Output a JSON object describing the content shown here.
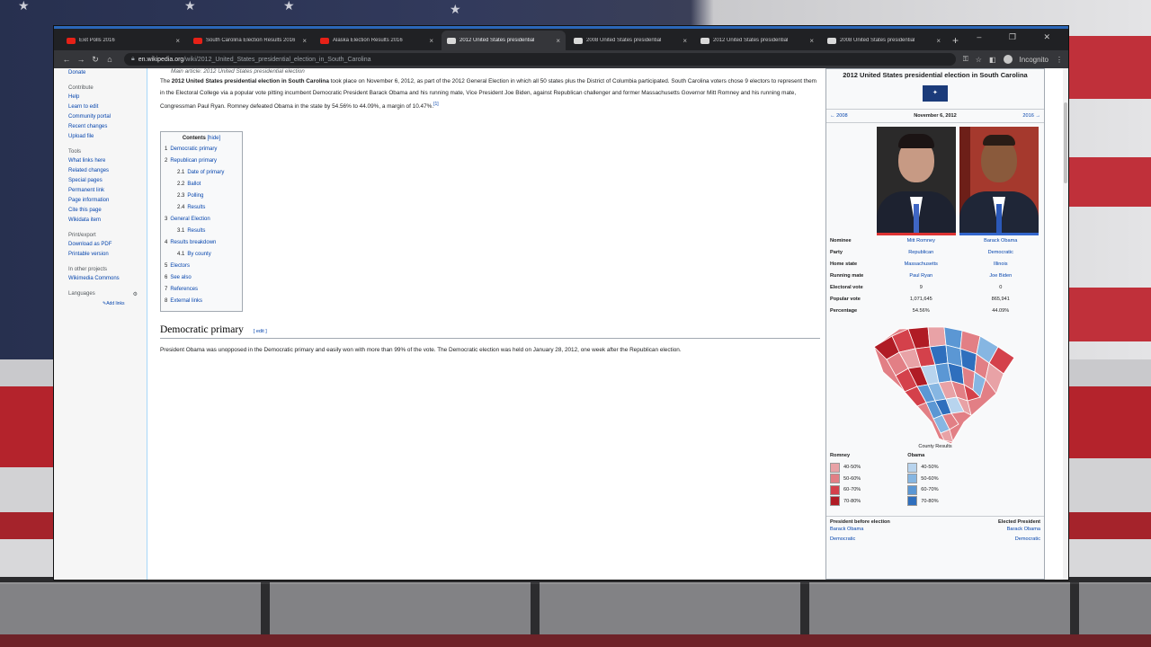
{
  "theme": {
    "republican": "#dd3333",
    "democratic": "#3366cc",
    "link": "#0645ad",
    "flag_blue": "#1b3b7a"
  },
  "browser": {
    "tabs": [
      {
        "title": "Exit Polls 2016",
        "icon": "youtube-icon",
        "active": false
      },
      {
        "title": "South Carolina Election Results 2016",
        "icon": "youtube-icon",
        "active": false
      },
      {
        "title": "Alaska Election Results 2016",
        "icon": "youtube-icon",
        "active": false
      },
      {
        "title": "2012 United States presidential",
        "icon": "wikipedia-icon",
        "active": true
      },
      {
        "title": "2008 United States presidential",
        "icon": "wikipedia-icon",
        "active": false
      },
      {
        "title": "2012 United States presidential",
        "icon": "wikipedia-icon",
        "active": false
      },
      {
        "title": "2008 United States presidential",
        "icon": "wikipedia-icon",
        "active": false
      }
    ],
    "new_tab": "+",
    "url_host": "en.wikipedia.org",
    "url_path": "/wiki/2012_United_States_presidential_election_in_South_Carolina",
    "profile_label": "Incognito"
  },
  "sidebar": {
    "top": [
      "Donate"
    ],
    "contribute_heading": "Contribute",
    "contribute": [
      "Help",
      "Learn to edit",
      "Community portal",
      "Recent changes",
      "Upload file"
    ],
    "tools_heading": "Tools",
    "tools": [
      "What links here",
      "Related changes",
      "Special pages",
      "Permanent link",
      "Page information",
      "Cite this page",
      "Wikidata item"
    ],
    "print_heading": "Print/export",
    "print": [
      "Download as PDF",
      "Printable version"
    ],
    "other_heading": "In other projects",
    "other": [
      "Wikimedia Commons"
    ],
    "languages_heading": "Languages",
    "add_links": "Add links"
  },
  "article": {
    "hatnote": "Main article: 2012 United States presidential election",
    "intro_bold": "2012 United States presidential election in South Carolina",
    "intro_pre": "The ",
    "intro_rest": " took place on November 6, 2012, as part of the 2012 General Election in which all 50 states plus the District of Columbia participated. South Carolina voters chose 9 electors to represent them in the Electoral College via a popular vote pitting incumbent Democratic President Barack Obama and his running mate, Vice President Joe Biden, against Republican challenger and former Massachusetts Governor Mitt Romney and his running mate, Congressman Paul Ryan. Romney defeated Obama in the state by 54.56% to 44.09%, a margin of 10.47%.",
    "footnote": "[1]",
    "toc_title": "Contents",
    "toc_hide": "[hide]",
    "toc": [
      {
        "num": "1",
        "label": "Democratic primary",
        "sub": false
      },
      {
        "num": "2",
        "label": "Republican primary",
        "sub": false
      },
      {
        "num": "2.1",
        "label": "Date of primary",
        "sub": true
      },
      {
        "num": "2.2",
        "label": "Ballot",
        "sub": true
      },
      {
        "num": "2.3",
        "label": "Polling",
        "sub": true
      },
      {
        "num": "2.4",
        "label": "Results",
        "sub": true
      },
      {
        "num": "3",
        "label": "General Election",
        "sub": false
      },
      {
        "num": "3.1",
        "label": "Results",
        "sub": true
      },
      {
        "num": "4",
        "label": "Results breakdown",
        "sub": false
      },
      {
        "num": "4.1",
        "label": "By county",
        "sub": true
      },
      {
        "num": "5",
        "label": "Electors",
        "sub": false
      },
      {
        "num": "6",
        "label": "See also",
        "sub": false
      },
      {
        "num": "7",
        "label": "References",
        "sub": false
      },
      {
        "num": "8",
        "label": "External links",
        "sub": false
      }
    ],
    "section_heading": "Democratic primary",
    "section_edit": "[ edit ]",
    "section_text": "President Obama was unopposed in the Democratic primary and easily won with more than 99% of the vote. The Democratic election was held on January 28, 2012, one week after the Republican election."
  },
  "infobox": {
    "title": "2012 United States presidential election in South Carolina",
    "prev": "← 2008",
    "date": "November 6, 2012",
    "next": "2016 →",
    "rows": [
      {
        "label": "Nominee",
        "r": "Mitt Romney",
        "d": "Barack Obama",
        "link": true
      },
      {
        "label": "Party",
        "r": "Republican",
        "d": "Democratic",
        "link": true
      },
      {
        "label": "Home state",
        "r": "Massachusetts",
        "d": "Illinois",
        "link": true
      },
      {
        "label": "Running mate",
        "r": "Paul Ryan",
        "d": "Joe Biden",
        "link": true
      },
      {
        "label": "Electoral vote",
        "r": "9",
        "d": "0",
        "link": false
      },
      {
        "label": "Popular vote",
        "r": "1,071,645",
        "d": "865,941",
        "link": false
      },
      {
        "label": "Percentage",
        "r": "54.56%",
        "d": "44.09%",
        "link": false
      }
    ],
    "map_caption": "County Results",
    "legend": {
      "romney_title": "Romney",
      "obama_title": "Obama",
      "romney": [
        {
          "label": "40-50%",
          "color": "#e8a2a6"
        },
        {
          "label": "50-60%",
          "color": "#e27f85"
        },
        {
          "label": "60-70%",
          "color": "#d4414b"
        },
        {
          "label": "70-80%",
          "color": "#b01c25"
        }
      ],
      "obama": [
        {
          "label": "40-50%",
          "color": "#b8d4ee"
        },
        {
          "label": "50-60%",
          "color": "#86b6e2"
        },
        {
          "label": "60-70%",
          "color": "#5b97d4"
        },
        {
          "label": "70-80%",
          "color": "#2f6fbd"
        }
      ]
    },
    "before_label": "President before election",
    "elected_label": "Elected President",
    "before_name": "Barack Obama",
    "before_party": "Democratic",
    "elected_name": "Barack Obama",
    "elected_party": "Democratic"
  }
}
